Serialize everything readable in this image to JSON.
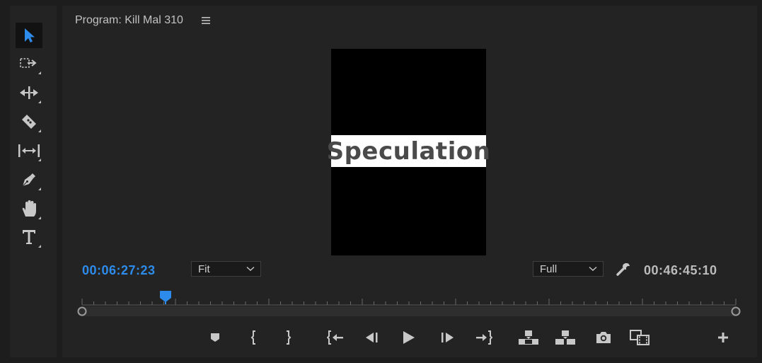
{
  "panel": {
    "title": "Program: Kill Mal 310"
  },
  "video": {
    "title_text": "Speculation"
  },
  "timecodes": {
    "current": "00:06:27:23",
    "duration": "00:46:45:10"
  },
  "zoom": {
    "selected": "Fit"
  },
  "resolution": {
    "selected": "Full"
  },
  "playhead_fraction": 0.128,
  "colors": {
    "accent": "#2d8ceb",
    "panel_bg": "#232323",
    "app_bg": "#1d1d1d"
  },
  "tools": [
    {
      "name": "selection-tool",
      "icon": "arrow-icon"
    },
    {
      "name": "track-select-tool",
      "icon": "track-select-icon"
    },
    {
      "name": "ripple-edit-tool",
      "icon": "ripple-edit-icon"
    },
    {
      "name": "razor-tool",
      "icon": "razor-icon"
    },
    {
      "name": "slip-tool",
      "icon": "slip-icon"
    },
    {
      "name": "pen-tool",
      "icon": "pen-icon"
    },
    {
      "name": "hand-tool",
      "icon": "hand-icon"
    },
    {
      "name": "type-tool",
      "icon": "type-icon"
    }
  ],
  "transport": [
    "add-marker",
    "mark-in",
    "mark-out",
    "go-to-in",
    "step-back",
    "play",
    "step-forward",
    "go-to-out",
    "lift",
    "extract",
    "export-frame",
    "compare-view",
    "add-button"
  ]
}
